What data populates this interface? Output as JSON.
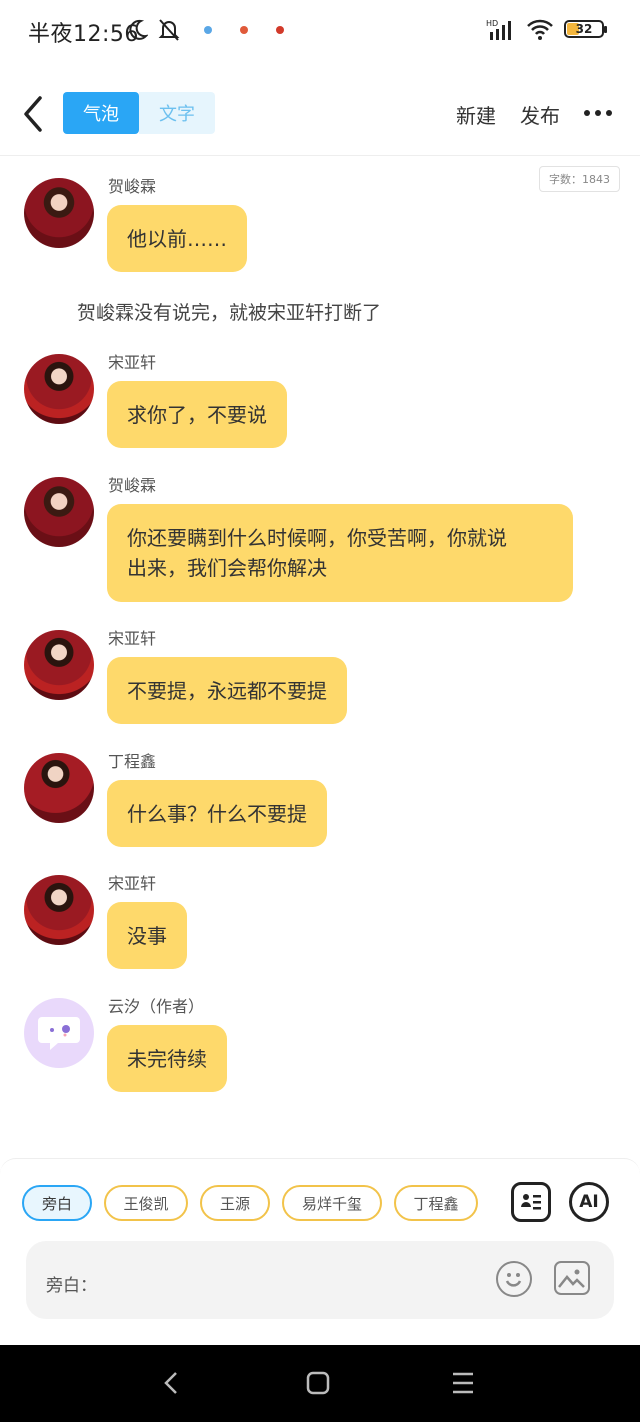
{
  "status_bar": {
    "time": "半夜12:56",
    "battery": "32"
  },
  "header": {
    "segments": [
      "气泡",
      "文字"
    ],
    "actions": {
      "new": "新建",
      "publish": "发布"
    }
  },
  "word_count": "字数：1843",
  "messages": [
    {
      "type": "bubble",
      "sender": "贺峻霖",
      "text": "他以前……"
    },
    {
      "type": "narration",
      "text": "贺峻霖没有说完，就被宋亚轩打断了"
    },
    {
      "type": "bubble",
      "sender": "宋亚轩",
      "text": "求你了，不要说"
    },
    {
      "type": "bubble",
      "sender": "贺峻霖",
      "lines": [
        "你还要瞒到什么时候啊，你受苦啊，你就说",
        "出来，我们会帮你解决"
      ]
    },
    {
      "type": "bubble",
      "sender": "宋亚轩",
      "text": "不要提，永远都不要提"
    },
    {
      "type": "bubble",
      "sender": "丁程鑫",
      "text": "什么事？什么不要提"
    },
    {
      "type": "bubble",
      "sender": "宋亚轩",
      "text": "没事"
    },
    {
      "type": "bubble",
      "sender": "云汐（作者）",
      "text": "未完待续"
    }
  ],
  "role_chips": [
    "旁白",
    "王俊凯",
    "王源",
    "易烊千玺",
    "丁程鑫"
  ],
  "ai_label": "AI",
  "input": {
    "label": "旁白：",
    "value": ""
  },
  "colors": {
    "accent": "#2aa6f5",
    "bubble": "#fed96b",
    "chip_border": "#f2c34a"
  }
}
